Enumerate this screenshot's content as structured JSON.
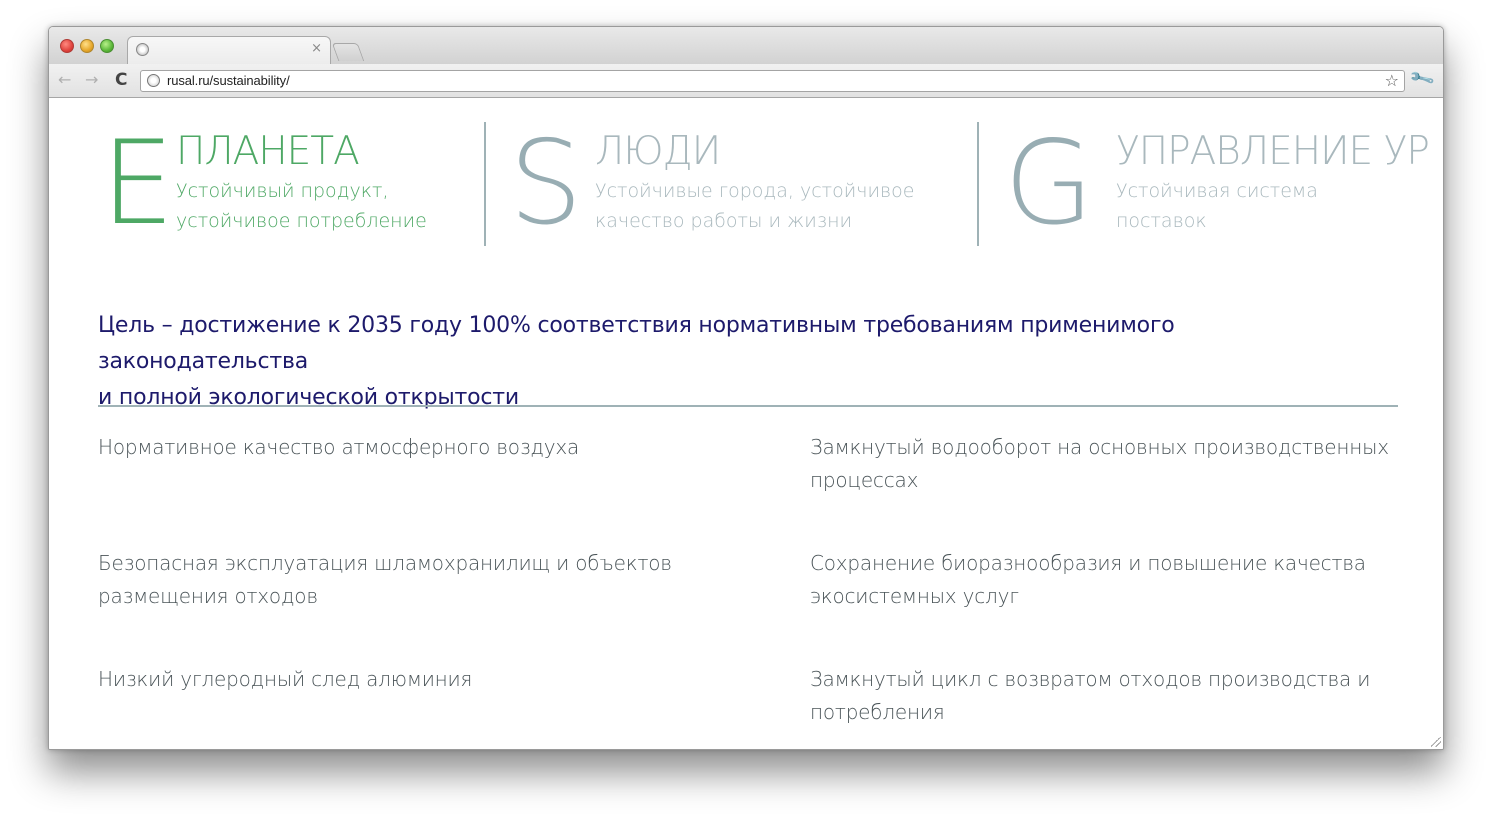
{
  "browser": {
    "tab_title": "",
    "tab_close": "×",
    "url": "rusal.ru/sustainability/",
    "nav": {
      "back": "←",
      "forward": "→",
      "reload": "C"
    },
    "bookmark_star": "☆",
    "wrench": "🔧",
    "icons": [
      "back-arrow-icon",
      "forward-arrow-icon",
      "reload-icon",
      "globe-icon",
      "star-icon",
      "wrench-icon"
    ]
  },
  "pillars": [
    {
      "letter": "E",
      "title": "ПЛАНЕТА",
      "desc_lines": [
        "Устойчивый продукт,",
        "устойчивое потребление"
      ],
      "color": "#4ea865"
    },
    {
      "letter": "S",
      "title": "ЛЮДИ",
      "desc_lines": [
        "Устойчивые города, устойчивое",
        "качество работы и жизни"
      ],
      "color": "#a9b8bd"
    },
    {
      "letter": "G",
      "title": "УПРАВЛЕНИЕ УР",
      "desc_lines": [
        "Устойчивая система",
        "поставок"
      ],
      "color": "#a9b8bd"
    }
  ],
  "goal": {
    "line1": "Цель – достижение к 2035 году 100% соответствия нормативным требованиям применимого законодательства",
    "line2": "и полной экологической открытости",
    "color": "#1d1a6b"
  },
  "items": [
    {
      "left": "Нормативное качество атмосферного воздуха",
      "right": "Замкнутый водооборот на основных производственных процессах"
    },
    {
      "left": "Безопасная эксплуатация шламохранилищ и объектов размещения отходов",
      "right": "Сохранение биоразнообразия и повышение качества экосистемных услуг"
    },
    {
      "left": "Низкий углеродный след алюминия",
      "right": "Замкнутый цикл с возвратом отходов производства и потребления"
    }
  ]
}
